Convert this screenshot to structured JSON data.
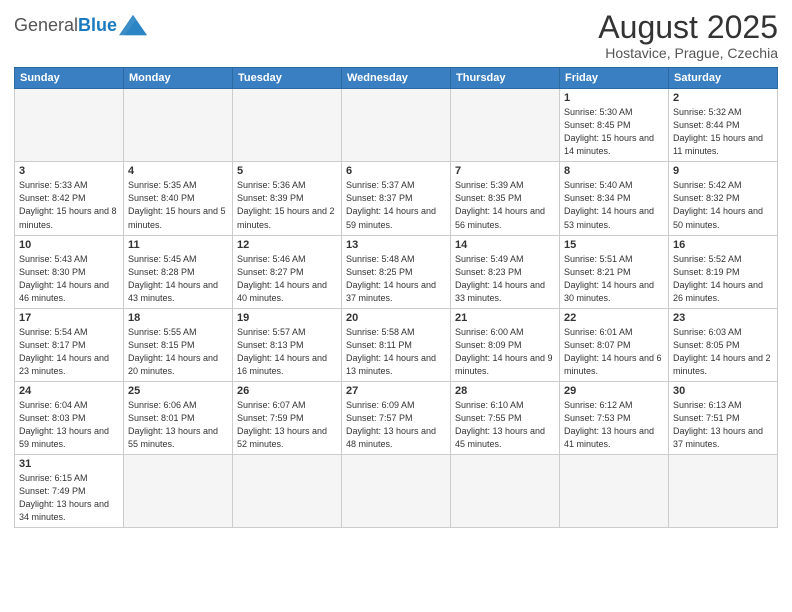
{
  "header": {
    "logo_general": "General",
    "logo_blue": "Blue",
    "title": "August 2025",
    "location": "Hostavice, Prague, Czechia"
  },
  "weekdays": [
    "Sunday",
    "Monday",
    "Tuesday",
    "Wednesday",
    "Thursday",
    "Friday",
    "Saturday"
  ],
  "weeks": [
    [
      {
        "day": "",
        "info": ""
      },
      {
        "day": "",
        "info": ""
      },
      {
        "day": "",
        "info": ""
      },
      {
        "day": "",
        "info": ""
      },
      {
        "day": "",
        "info": ""
      },
      {
        "day": "1",
        "info": "Sunrise: 5:30 AM\nSunset: 8:45 PM\nDaylight: 15 hours and 14 minutes."
      },
      {
        "day": "2",
        "info": "Sunrise: 5:32 AM\nSunset: 8:44 PM\nDaylight: 15 hours and 11 minutes."
      }
    ],
    [
      {
        "day": "3",
        "info": "Sunrise: 5:33 AM\nSunset: 8:42 PM\nDaylight: 15 hours and 8 minutes."
      },
      {
        "day": "4",
        "info": "Sunrise: 5:35 AM\nSunset: 8:40 PM\nDaylight: 15 hours and 5 minutes."
      },
      {
        "day": "5",
        "info": "Sunrise: 5:36 AM\nSunset: 8:39 PM\nDaylight: 15 hours and 2 minutes."
      },
      {
        "day": "6",
        "info": "Sunrise: 5:37 AM\nSunset: 8:37 PM\nDaylight: 14 hours and 59 minutes."
      },
      {
        "day": "7",
        "info": "Sunrise: 5:39 AM\nSunset: 8:35 PM\nDaylight: 14 hours and 56 minutes."
      },
      {
        "day": "8",
        "info": "Sunrise: 5:40 AM\nSunset: 8:34 PM\nDaylight: 14 hours and 53 minutes."
      },
      {
        "day": "9",
        "info": "Sunrise: 5:42 AM\nSunset: 8:32 PM\nDaylight: 14 hours and 50 minutes."
      }
    ],
    [
      {
        "day": "10",
        "info": "Sunrise: 5:43 AM\nSunset: 8:30 PM\nDaylight: 14 hours and 46 minutes."
      },
      {
        "day": "11",
        "info": "Sunrise: 5:45 AM\nSunset: 8:28 PM\nDaylight: 14 hours and 43 minutes."
      },
      {
        "day": "12",
        "info": "Sunrise: 5:46 AM\nSunset: 8:27 PM\nDaylight: 14 hours and 40 minutes."
      },
      {
        "day": "13",
        "info": "Sunrise: 5:48 AM\nSunset: 8:25 PM\nDaylight: 14 hours and 37 minutes."
      },
      {
        "day": "14",
        "info": "Sunrise: 5:49 AM\nSunset: 8:23 PM\nDaylight: 14 hours and 33 minutes."
      },
      {
        "day": "15",
        "info": "Sunrise: 5:51 AM\nSunset: 8:21 PM\nDaylight: 14 hours and 30 minutes."
      },
      {
        "day": "16",
        "info": "Sunrise: 5:52 AM\nSunset: 8:19 PM\nDaylight: 14 hours and 26 minutes."
      }
    ],
    [
      {
        "day": "17",
        "info": "Sunrise: 5:54 AM\nSunset: 8:17 PM\nDaylight: 14 hours and 23 minutes."
      },
      {
        "day": "18",
        "info": "Sunrise: 5:55 AM\nSunset: 8:15 PM\nDaylight: 14 hours and 20 minutes."
      },
      {
        "day": "19",
        "info": "Sunrise: 5:57 AM\nSunset: 8:13 PM\nDaylight: 14 hours and 16 minutes."
      },
      {
        "day": "20",
        "info": "Sunrise: 5:58 AM\nSunset: 8:11 PM\nDaylight: 14 hours and 13 minutes."
      },
      {
        "day": "21",
        "info": "Sunrise: 6:00 AM\nSunset: 8:09 PM\nDaylight: 14 hours and 9 minutes."
      },
      {
        "day": "22",
        "info": "Sunrise: 6:01 AM\nSunset: 8:07 PM\nDaylight: 14 hours and 6 minutes."
      },
      {
        "day": "23",
        "info": "Sunrise: 6:03 AM\nSunset: 8:05 PM\nDaylight: 14 hours and 2 minutes."
      }
    ],
    [
      {
        "day": "24",
        "info": "Sunrise: 6:04 AM\nSunset: 8:03 PM\nDaylight: 13 hours and 59 minutes."
      },
      {
        "day": "25",
        "info": "Sunrise: 6:06 AM\nSunset: 8:01 PM\nDaylight: 13 hours and 55 minutes."
      },
      {
        "day": "26",
        "info": "Sunrise: 6:07 AM\nSunset: 7:59 PM\nDaylight: 13 hours and 52 minutes."
      },
      {
        "day": "27",
        "info": "Sunrise: 6:09 AM\nSunset: 7:57 PM\nDaylight: 13 hours and 48 minutes."
      },
      {
        "day": "28",
        "info": "Sunrise: 6:10 AM\nSunset: 7:55 PM\nDaylight: 13 hours and 45 minutes."
      },
      {
        "day": "29",
        "info": "Sunrise: 6:12 AM\nSunset: 7:53 PM\nDaylight: 13 hours and 41 minutes."
      },
      {
        "day": "30",
        "info": "Sunrise: 6:13 AM\nSunset: 7:51 PM\nDaylight: 13 hours and 37 minutes."
      }
    ],
    [
      {
        "day": "31",
        "info": "Sunrise: 6:15 AM\nSunset: 7:49 PM\nDaylight: 13 hours and 34 minutes."
      },
      {
        "day": "",
        "info": ""
      },
      {
        "day": "",
        "info": ""
      },
      {
        "day": "",
        "info": ""
      },
      {
        "day": "",
        "info": ""
      },
      {
        "day": "",
        "info": ""
      },
      {
        "day": "",
        "info": ""
      }
    ]
  ]
}
